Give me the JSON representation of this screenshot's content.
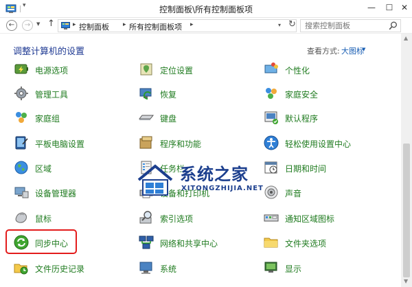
{
  "window": {
    "title": "控制面板\\所有控制面板项",
    "minimize_glyph": "—",
    "maximize_glyph": "☐",
    "close_glyph": "✕"
  },
  "nav": {
    "back_glyph": "←",
    "forward_glyph": "→",
    "recent_glyph": "▼",
    "up_glyph": "↑",
    "breadcrumb": [
      "控制面板",
      "所有控制面板项"
    ],
    "chevron": "▸",
    "dropdown_glyph": "▾",
    "refresh_glyph": "↻"
  },
  "search": {
    "placeholder": "搜索控制面板"
  },
  "header": {
    "title": "调整计算机的设置",
    "view_by_label": "查看方式:",
    "view_by_value": "大图标",
    "view_by_chevron": "▼"
  },
  "columns": [
    {
      "items": [
        {
          "label": "电源选项",
          "icon": "power-options-icon"
        },
        {
          "label": "管理工具",
          "icon": "admin-tools-icon"
        },
        {
          "label": "家庭组",
          "icon": "homegroup-icon"
        },
        {
          "label": "平板电脑设置",
          "icon": "tablet-settings-icon"
        },
        {
          "label": "区域",
          "icon": "region-icon"
        },
        {
          "label": "设备管理器",
          "icon": "device-manager-icon"
        },
        {
          "label": "鼠标",
          "icon": "mouse-icon"
        },
        {
          "label": "同步中心",
          "icon": "sync-center-icon"
        },
        {
          "label": "文件历史记录",
          "icon": "file-history-icon"
        }
      ]
    },
    {
      "items": [
        {
          "label": "定位设置",
          "icon": "location-settings-icon"
        },
        {
          "label": "恢复",
          "icon": "recovery-icon"
        },
        {
          "label": "键盘",
          "icon": "keyboard-icon"
        },
        {
          "label": "程序和功能",
          "icon": "programs-features-icon"
        },
        {
          "label": "任务栏",
          "icon": "taskbar-icon"
        },
        {
          "label": "设备和打印机",
          "icon": "devices-printers-icon"
        },
        {
          "label": "索引选项",
          "icon": "indexing-options-icon"
        },
        {
          "label": "网络和共享中心",
          "icon": "network-sharing-icon"
        },
        {
          "label": "系统",
          "icon": "system-icon"
        }
      ]
    },
    {
      "items": [
        {
          "label": "个性化",
          "icon": "personalization-icon"
        },
        {
          "label": "家庭安全",
          "icon": "family-safety-icon"
        },
        {
          "label": "默认程序",
          "icon": "default-programs-icon"
        },
        {
          "label": "轻松使用设置中心",
          "icon": "ease-of-access-icon"
        },
        {
          "label": "日期和时间",
          "icon": "date-time-icon"
        },
        {
          "label": "声音",
          "icon": "sound-icon"
        },
        {
          "label": "通知区域图标",
          "icon": "notification-icons-icon"
        },
        {
          "label": "文件夹选项",
          "icon": "folder-options-icon"
        },
        {
          "label": "显示",
          "icon": "display-icon"
        }
      ]
    }
  ],
  "watermark": {
    "text_cn": "系统之家",
    "text_en": "XITONGZHIJIA.NET"
  }
}
